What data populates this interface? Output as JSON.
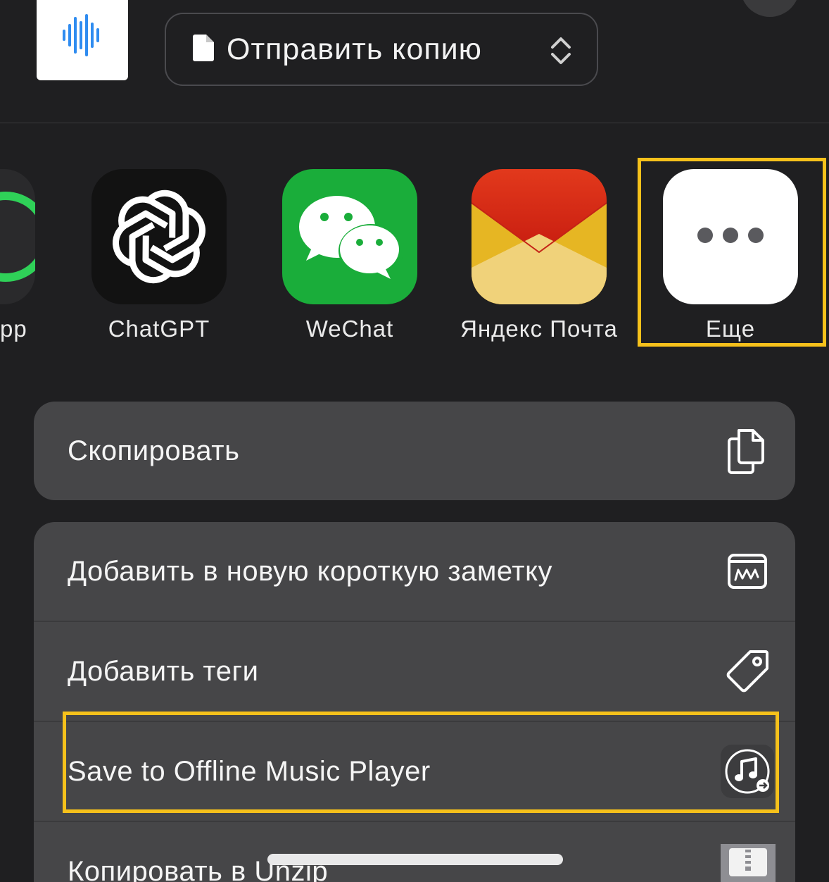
{
  "header": {
    "file_thumb_icon": "audio-waveform-icon",
    "send_mode_label": "Отправить копию",
    "send_mode_icon": "document-icon",
    "send_mode_chevron": "chevron-updown-icon"
  },
  "apps": [
    {
      "label": "pp",
      "icon": "whatsapp-icon"
    },
    {
      "label": "ChatGPT",
      "icon": "chatgpt-icon"
    },
    {
      "label": "WeChat",
      "icon": "wechat-icon"
    },
    {
      "label": "Яндекс Почта",
      "icon": "yandex-mail-icon"
    },
    {
      "label": "Еще",
      "icon": "more-dots-icon"
    }
  ],
  "actions": {
    "copy": {
      "label": "Скопировать",
      "icon": "copy-icon"
    },
    "add_quick_note": {
      "label": "Добавить в новую короткую заметку",
      "icon": "quick-note-icon"
    },
    "add_tags": {
      "label": "Добавить теги",
      "icon": "tag-icon"
    },
    "offline_music": {
      "label": "Save to Offline Music Player",
      "icon": "music-note-icon"
    },
    "copy_to_unzip": {
      "label": "Копировать в Unzip",
      "icon": "zip-icon"
    }
  },
  "colors": {
    "background": "#1f1f21",
    "group_background": "#464648",
    "highlight": "#f6c11b",
    "wechat_green": "#1aad3a",
    "waveform_blue": "#2f8cf0"
  }
}
